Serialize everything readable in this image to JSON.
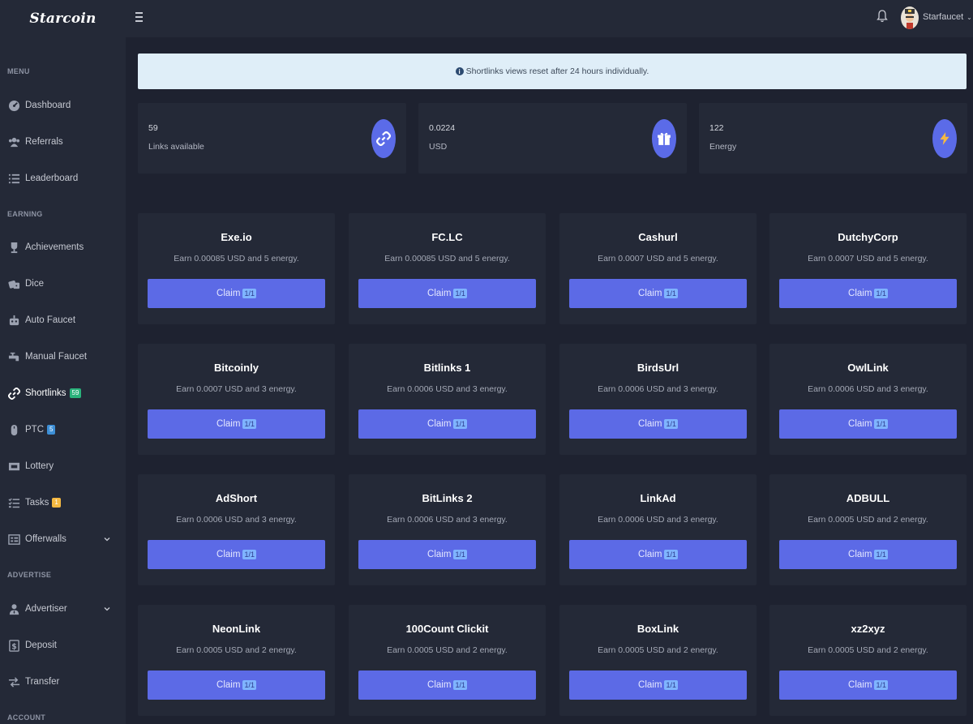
{
  "brand": {
    "name": "Starcoin"
  },
  "sidebar": {
    "sections": [
      {
        "label": "MENU"
      },
      {
        "label": "EARNING"
      },
      {
        "label": "ADVERTISE"
      },
      {
        "label": "ACCOUNT"
      }
    ],
    "items": [
      {
        "label": "Dashboard",
        "icon": "dashboard-icon"
      },
      {
        "label": "Referrals",
        "icon": "users-icon"
      },
      {
        "label": "Leaderboard",
        "icon": "list-icon"
      },
      {
        "label": "Achievements",
        "icon": "trophy-icon"
      },
      {
        "label": "Dice",
        "icon": "dice-icon"
      },
      {
        "label": "Auto Faucet",
        "icon": "robot-icon"
      },
      {
        "label": "Manual Faucet",
        "icon": "faucet-icon"
      },
      {
        "label": "Shortlinks",
        "icon": "link-icon",
        "badge": "59"
      },
      {
        "label": "PTC",
        "icon": "mouse-icon",
        "badge": "5"
      },
      {
        "label": "Lottery",
        "icon": "ticket-icon"
      },
      {
        "label": "Tasks",
        "icon": "tasks-icon",
        "badge": "1"
      },
      {
        "label": "Offerwalls",
        "icon": "offerwall-icon"
      },
      {
        "label": "Advertiser",
        "icon": "advertiser-icon"
      },
      {
        "label": "Deposit",
        "icon": "dollar-icon"
      },
      {
        "label": "Transfer",
        "icon": "transfer-icon"
      }
    ]
  },
  "topbar": {
    "username": "Starfaucet"
  },
  "alert": {
    "text": "Shortlinks views reset after 24 hours individually."
  },
  "stats": [
    {
      "value": "59",
      "label": "Links available",
      "icon": "link-icon"
    },
    {
      "value": "0.0224",
      "label": "USD",
      "icon": "gift-icon"
    },
    {
      "value": "122",
      "label": "Energy",
      "icon": "bolt-icon"
    }
  ],
  "claim_label": "Claim",
  "links": [
    {
      "name": "Exe.io",
      "desc": "Earn 0.00085 USD and 5 energy.",
      "count": "1/1"
    },
    {
      "name": "FC.LC",
      "desc": "Earn 0.00085 USD and 5 energy.",
      "count": "1/1"
    },
    {
      "name": "Cashurl",
      "desc": "Earn 0.0007 USD and 5 energy.",
      "count": "1/1"
    },
    {
      "name": "DutchyCorp",
      "desc": "Earn 0.0007 USD and 5 energy.",
      "count": "1/1"
    },
    {
      "name": "Bitcoinly",
      "desc": "Earn 0.0007 USD and 3 energy.",
      "count": "1/1"
    },
    {
      "name": "Bitlinks 1",
      "desc": "Earn 0.0006 USD and 3 energy.",
      "count": "1/1"
    },
    {
      "name": "BirdsUrl",
      "desc": "Earn 0.0006 USD and 3 energy.",
      "count": "1/1"
    },
    {
      "name": "OwlLink",
      "desc": "Earn 0.0006 USD and 3 energy.",
      "count": "1/1"
    },
    {
      "name": "AdShort",
      "desc": "Earn 0.0006 USD and 3 energy.",
      "count": "1/1"
    },
    {
      "name": "BitLinks 2",
      "desc": "Earn 0.0006 USD and 3 energy.",
      "count": "1/1"
    },
    {
      "name": "LinkAd",
      "desc": "Earn 0.0006 USD and 3 energy.",
      "count": "1/1"
    },
    {
      "name": "ADBULL",
      "desc": "Earn 0.0005 USD and 2 energy.",
      "count": "1/1"
    },
    {
      "name": "NeonLink",
      "desc": "Earn 0.0005 USD and 2 energy.",
      "count": "1/1"
    },
    {
      "name": "100Count Clickit",
      "desc": "Earn 0.0005 USD and 2 energy.",
      "count": "1/1"
    },
    {
      "name": "BoxLink",
      "desc": "Earn 0.0005 USD and 2 energy.",
      "count": "1/1"
    },
    {
      "name": "xz2xyz",
      "desc": "Earn 0.0005 USD and 2 energy.",
      "count": "1/1"
    }
  ],
  "colors": {
    "accent": "#5c6ae6",
    "background": "#1e2230",
    "panel": "#242937",
    "alert_bg": "#dfeef8",
    "badge_green": "#2ab27b",
    "badge_blue": "#3d8fd6",
    "badge_yellow": "#f5b942"
  }
}
